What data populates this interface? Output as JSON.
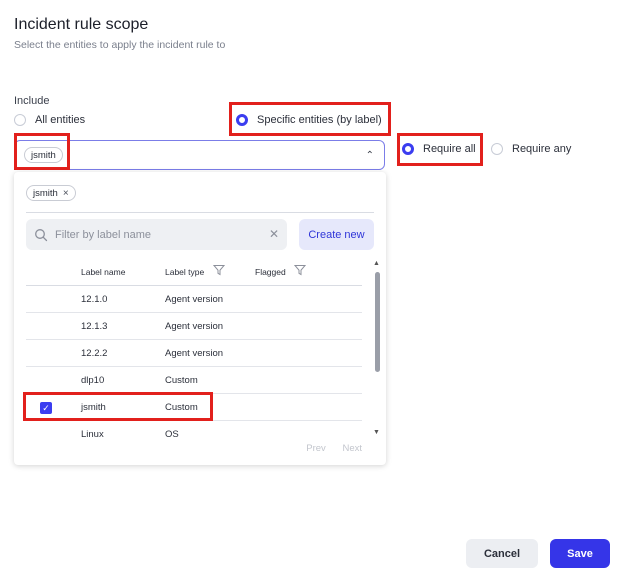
{
  "header": {
    "title": "Incident rule scope",
    "subtitle": "Select the entities to apply the incident rule to"
  },
  "include": {
    "label": "Include",
    "options": [
      {
        "label": "All entities",
        "selected": false
      },
      {
        "label": "Specific entities (by label)",
        "selected": true
      }
    ]
  },
  "match": {
    "options": [
      {
        "label": "Require all",
        "selected": true
      },
      {
        "label": "Require any",
        "selected": false
      }
    ]
  },
  "label_select": {
    "selected_chip": "jsmith",
    "expanded": true
  },
  "dropdown": {
    "selected_chip": "jsmith",
    "filter_placeholder": "Filter by label name",
    "filter_value": "",
    "create_label": "Create new",
    "columns": [
      "Label name",
      "Label type",
      "Flagged"
    ],
    "rows": [
      {
        "name": "12.1.0",
        "type": "Agent version",
        "flagged": "",
        "checked": false
      },
      {
        "name": "12.1.3",
        "type": "Agent version",
        "flagged": "",
        "checked": false
      },
      {
        "name": "12.2.2",
        "type": "Agent version",
        "flagged": "",
        "checked": false
      },
      {
        "name": "dlp10",
        "type": "Custom",
        "flagged": "",
        "checked": false
      },
      {
        "name": "jsmith",
        "type": "Custom",
        "flagged": "",
        "checked": true
      },
      {
        "name": "Linux",
        "type": "OS",
        "flagged": "",
        "checked": false
      }
    ],
    "pager": {
      "prev": "Prev",
      "next": "Next"
    }
  },
  "footer": {
    "cancel_label": "Cancel",
    "save_label": "Save"
  },
  "colors": {
    "accent": "#3b3df0",
    "highlight": "#e2201c"
  }
}
